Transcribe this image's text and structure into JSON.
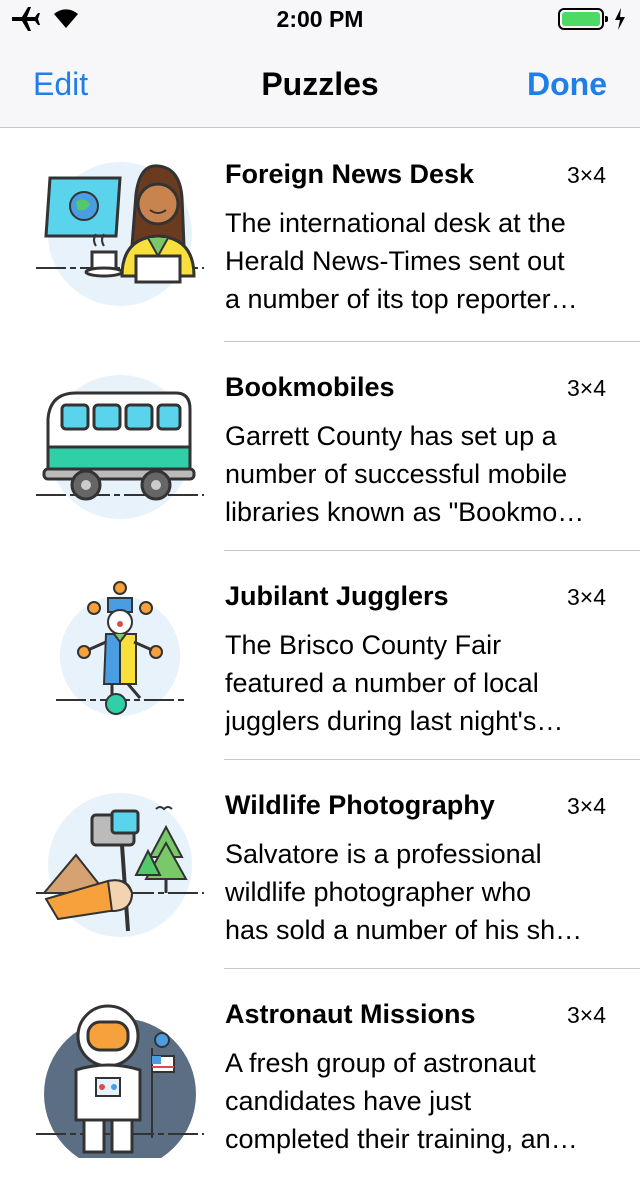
{
  "status_bar": {
    "time": "2:00 PM"
  },
  "nav": {
    "edit_label": "Edit",
    "title": "Puzzles",
    "done_label": "Done"
  },
  "puzzles": [
    {
      "title": "Foreign News Desk",
      "size": "3×4",
      "lines": [
        "The international desk at the",
        "Herald News-Times sent out",
        "a number of its top reporter…"
      ]
    },
    {
      "title": "Bookmobiles",
      "size": "3×4",
      "lines": [
        "Garrett County has set up a",
        "number of successful mobile",
        "libraries known as \"Bookmo…"
      ]
    },
    {
      "title": "Jubilant Jugglers",
      "size": "3×4",
      "lines": [
        "The Brisco County Fair",
        "featured a number of local",
        "jugglers during last night's…"
      ]
    },
    {
      "title": "Wildlife Photography",
      "size": "3×4",
      "lines": [
        "Salvatore is a professional",
        "wildlife photographer who",
        "has sold a number of his sh…"
      ]
    },
    {
      "title": "Astronaut Missions",
      "size": "3×4",
      "lines": [
        "A fresh group of astronaut",
        "candidates have just",
        "completed their training, an…"
      ]
    }
  ]
}
